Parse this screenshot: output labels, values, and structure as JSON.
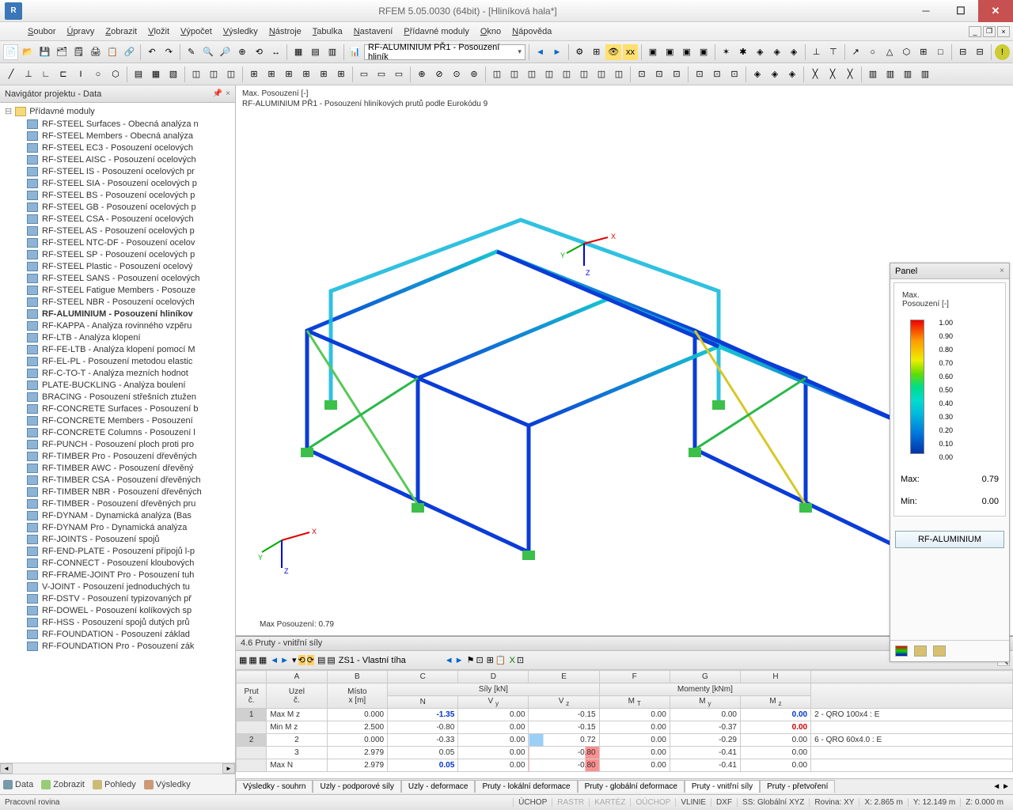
{
  "title": "RFEM 5.05.0030 (64bit) - [Hliníková hala*]",
  "menus": [
    "Soubor",
    "Úpravy",
    "Zobrazit",
    "Vložit",
    "Výpočet",
    "Výsledky",
    "Nástroje",
    "Tabulka",
    "Nastavení",
    "Přídavné moduly",
    "Okno",
    "Nápověda"
  ],
  "combo_module": "RF-ALUMINIUM PŘ1 - Posouzení hliník",
  "navigator": {
    "title": "Navigátor projektu - Data",
    "root": "Přídavné moduly",
    "items": [
      "RF-STEEL Surfaces - Obecná analýza n",
      "RF-STEEL Members - Obecná analýza ",
      "RF-STEEL EC3 - Posouzení ocelových ",
      "RF-STEEL AISC - Posouzení ocelových",
      "RF-STEEL IS - Posouzení ocelových pr",
      "RF-STEEL SIA - Posouzení ocelových p",
      "RF-STEEL BS - Posouzení ocelových p",
      "RF-STEEL GB - Posouzení ocelových p",
      "RF-STEEL CSA - Posouzení ocelových",
      "RF-STEEL AS - Posouzení ocelových p",
      "RF-STEEL NTC-DF - Posouzení ocelov",
      "RF-STEEL SP - Posouzení ocelových p",
      "RF-STEEL Plastic - Posouzení ocelový",
      "RF-STEEL SANS - Posouzení ocelových",
      "RF-STEEL Fatigue Members - Posouze",
      "RF-STEEL NBR - Posouzení ocelových ",
      "RF-ALUMINIUM - Posouzení hliníkov",
      "RF-KAPPA - Analýza rovinného vzpěru",
      "RF-LTB - Analýza klopení",
      "RF-FE-LTB - Analýza klopení pomocí M",
      "RF-EL-PL - Posouzení metodou elastic",
      "RF-C-TO-T - Analýza mezních hodnot ",
      "PLATE-BUCKLING - Analýza boulení ",
      "BRACING - Posouzení střešních ztužen",
      "RF-CONCRETE Surfaces - Posouzení b",
      "RF-CONCRETE Members - Posouzení ",
      "RF-CONCRETE Columns - Posouzení l",
      "RF-PUNCH - Posouzení ploch proti pro",
      "RF-TIMBER Pro - Posouzení dřevěných",
      "RF-TIMBER AWC - Posouzení dřevěný",
      "RF-TIMBER CSA - Posouzení dřevěných",
      "RF-TIMBER NBR - Posouzení dřevěných",
      "RF-TIMBER - Posouzení dřevěných pru",
      "RF-DYNAM - Dynamická analýza (Bas",
      "RF-DYNAM Pro - Dynamická analýza ",
      "RF-JOINTS - Posouzení spojů",
      "RF-END-PLATE - Posouzení přípojů l-p",
      "RF-CONNECT - Posouzení kloubových",
      "RF-FRAME-JOINT Pro - Posouzení tuh",
      "V-JOINT - Posouzení jednoduchých tu",
      "RF-DSTV - Posouzení typizovaných př",
      "RF-DOWEL - Posouzení kolíkových sp",
      "RF-HSS - Posouzení spojů dutých prů",
      "RF-FOUNDATION - Posouzení základ",
      "RF-FOUNDATION Pro - Posouzení zák"
    ],
    "selected_index": 16,
    "tabs": [
      "Data",
      "Zobrazit",
      "Pohledy",
      "Výsledky"
    ]
  },
  "canvas": {
    "line1": "Max. Posouzení [-]",
    "line2": "RF-ALUMINIUM PŘ1 - Posouzení hliníkových prutů podle Eurokódu 9",
    "footer": "Max Posouzení: 0.79"
  },
  "panel": {
    "title": "Panel",
    "heading1": "Max.",
    "heading2": "Posouzení [-]",
    "grad_labels": [
      "1.00",
      "0.90",
      "0.80",
      "0.70",
      "0.60",
      "0.50",
      "0.40",
      "0.30",
      "0.20",
      "0.10",
      "0.00"
    ],
    "max_label": "Max:",
    "max_val": "0.79",
    "min_label": "Min:",
    "min_val": "0.00",
    "button": "RF-ALUMINIUM"
  },
  "table": {
    "title": "4.6 Pruty - vnitřní síly",
    "combo": "ZS1 - Vlastní tíha",
    "cols_top": [
      "",
      "A",
      "B",
      "C",
      "D",
      "E",
      "F",
      "G",
      "H",
      ""
    ],
    "header_groups": {
      "prut": "Prut\nč.",
      "uzel": "Uzel\nč.",
      "misto": "Místo\nx [m]",
      "sily": "Síly [kN]",
      "sily_sub": [
        "N",
        "V y",
        "V z"
      ],
      "mom": "Momenty [kNm]",
      "mom_sub": [
        "M T",
        "M y",
        "M z"
      ],
      "blank": ""
    },
    "rows": [
      {
        "no": "1",
        "uzel": "Max M z",
        "x": "0.000",
        "N": "-1.35",
        "Vy": "0.00",
        "Vz": "-0.15",
        "MT": "0.00",
        "My": "0.00",
        "Mz": "0.00",
        "cmt": "2 - QRO 100x4 : E",
        "n_class": "blue-bold",
        "mz_class": "blue-bold",
        "row_sel": true
      },
      {
        "no": "",
        "uzel": "Min M z",
        "x": "2.500",
        "N": "-0.80",
        "Vy": "0.00",
        "Vz": "-0.15",
        "MT": "0.00",
        "My": "-0.37",
        "Mz": "0.00",
        "cmt": "",
        "mz_class": "red-bold"
      },
      {
        "no": "2",
        "uzel": "2",
        "x": "0.000",
        "N": "-0.33",
        "Vy": "0.00",
        "Vz": "0.72",
        "MT": "0.00",
        "My": "-0.29",
        "Mz": "0.00",
        "cmt": "6 - QRO 60x4.0 : E",
        "row_sel": true,
        "vz_bar": "pos"
      },
      {
        "no": "",
        "uzel": "3",
        "x": "2.979",
        "N": "0.05",
        "Vy": "0.00",
        "Vz": "-0.80",
        "MT": "0.00",
        "My": "-0.41",
        "Mz": "0.00",
        "cmt": "",
        "vz_bar": "neg"
      },
      {
        "no": "",
        "uzel": "Max N",
        "x": "2.979",
        "N": "0.05",
        "Vy": "0.00",
        "Vz": "-0.80",
        "MT": "0.00",
        "My": "-0.41",
        "Mz": "0.00",
        "cmt": "",
        "n_class": "blue-bold",
        "vz_bar": "neg"
      }
    ],
    "tabs": [
      "Výsledky - souhrn",
      "Uzly - podporové síly",
      "Uzly - deformace",
      "Pruty - lokální deformace",
      "Pruty - globální deformace",
      "Pruty - vnitřní síly",
      "Pruty - přetvoření"
    ],
    "active_tab": 5
  },
  "status": {
    "left": "Pracovní rovina",
    "mids": [
      "ÚCHOP",
      "RASTR",
      "KARTÉZ",
      "OÚCHOP",
      "VLINIE",
      "DXF"
    ],
    "ss": "SS: Globální XYZ",
    "rovina": "Rovina: XY",
    "x": "X: 2.865 m",
    "y": "Y: 12.149 m",
    "z": "Z: 0.000 m"
  }
}
